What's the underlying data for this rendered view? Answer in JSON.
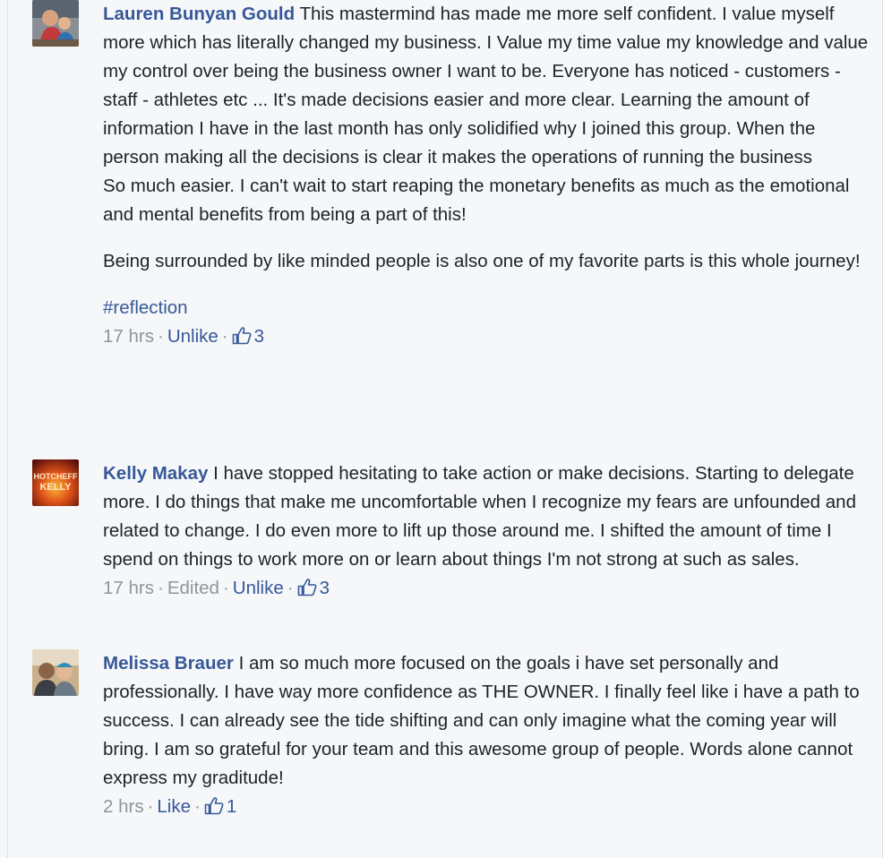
{
  "comments": [
    {
      "author": "Lauren Bunyan Gould",
      "text": "This mastermind has made me more self confident. I value myself more which has literally changed my business. I Value my time value my knowledge and value my control over being the business owner I want to be. Everyone has noticed - customers - staff - athletes etc ... It's made decisions easier and more clear. Learning the amount of information I have in the last month has only solidified why I joined this group. When the person making all the decisions is clear it makes the operations of running the business\nSo much easier. I can't wait to start reaping the monetary benefits as much as the emotional and mental benefits from being a part of this!",
      "paragraph2": "Being surrounded by like minded people is also one of my favorite parts is this whole journey!",
      "hashtag": "#reflection",
      "time": "17 hrs",
      "edited": "",
      "action": "Unlike",
      "likes": "3"
    },
    {
      "author": "Kelly Makay",
      "text": "I have stopped hesitating to take action or make decisions. Starting to delegate more. I do things that make me uncomfortable when I recognize my fears are unfounded and related to change. I do even more to lift up those around me. I shifted the amount of time I spend on things to work more on or learn about things I'm not strong at such as sales.",
      "avatar_text_top": "HOTCHEFF",
      "avatar_text_bottom": "KELLY",
      "time": "17 hrs",
      "edited": "Edited",
      "action": "Unlike",
      "likes": "3"
    },
    {
      "author": "Melissa Brauer",
      "text": "I am so much more focused on the goals i have set personally and professionally. I have way more confidence as THE OWNER. I finally feel like i have a path to success. I can already see the tide shifting and can only imagine what the coming year will bring. I am so grateful for your team and this awesome group of people. Words alone cannot express my graditude!",
      "time": "2 hrs",
      "edited": "",
      "action": "Like",
      "likes": "1"
    }
  ],
  "colors": {
    "link": "#365899",
    "text": "#1d2129",
    "meta": "#90949c",
    "background": "#f6f7f9"
  },
  "icons": {
    "like": "thumbs-up-icon"
  }
}
